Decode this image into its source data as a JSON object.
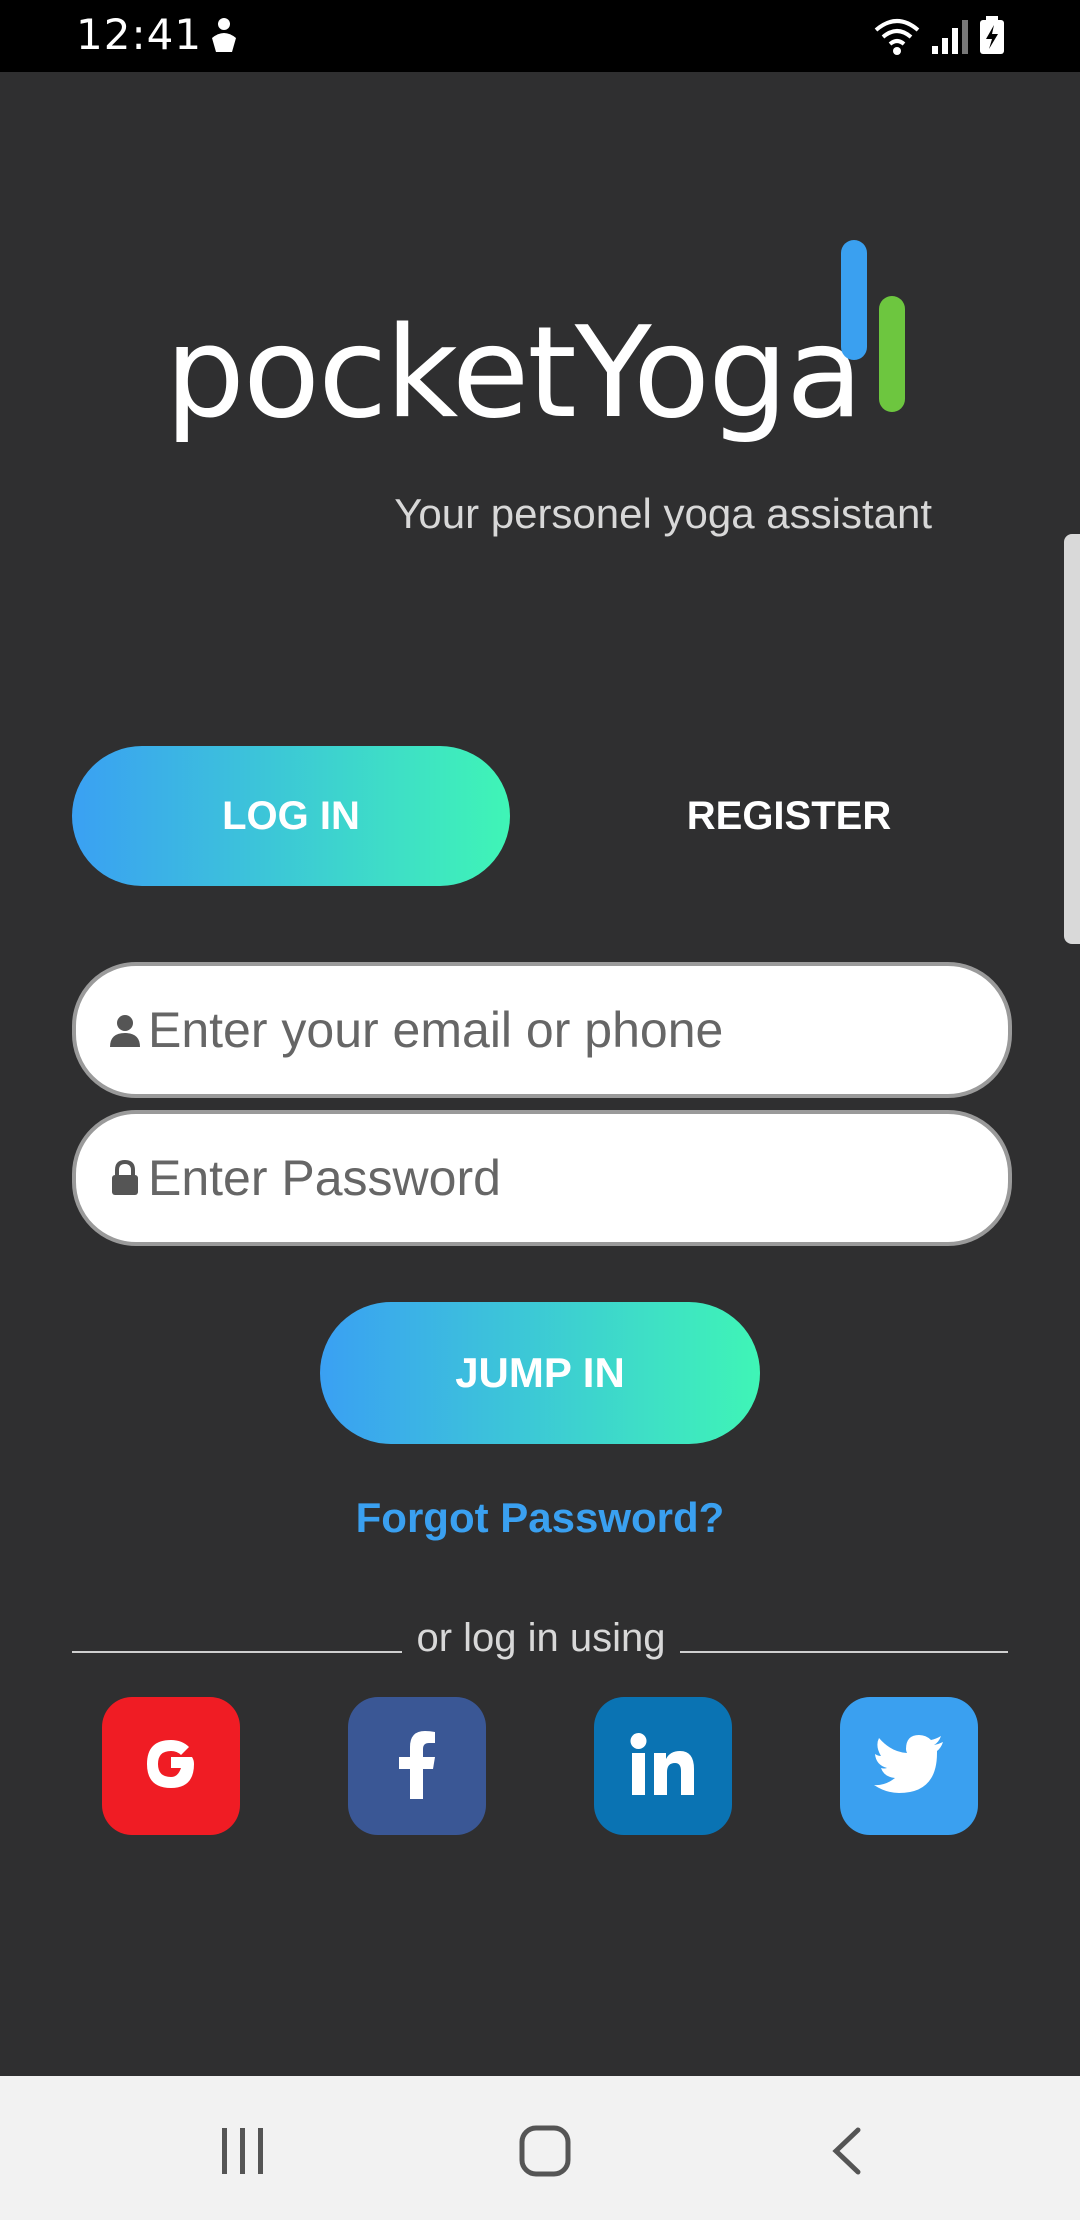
{
  "status_bar": {
    "time": "12:41"
  },
  "app": {
    "logo_text": "pocketYoga",
    "tagline": "Your personel yoga assistant",
    "brand_colors": {
      "blue": "#3aa0f0",
      "green": "#6dc63f",
      "gradient_start": "#3aa0f3",
      "gradient_end": "#3ff5b6"
    }
  },
  "tabs": {
    "login_label": "LOG IN",
    "register_label": "REGISTER",
    "active": "login"
  },
  "form": {
    "email_placeholder": "Enter your email or phone",
    "email_value": "",
    "email_icon": "person-icon",
    "password_placeholder": "Enter Password",
    "password_value": "",
    "password_icon": "lock-icon",
    "submit_label": "JUMP IN",
    "forgot_label": "Forgot Password?"
  },
  "social": {
    "divider_label": "or log in using",
    "providers": [
      {
        "name": "google",
        "icon": "google-icon",
        "color": "#f01c24"
      },
      {
        "name": "facebook",
        "icon": "facebook-icon",
        "color": "#3a5795"
      },
      {
        "name": "linkedin",
        "icon": "linkedin-icon",
        "color": "#0a73b3"
      },
      {
        "name": "twitter",
        "icon": "twitter-icon",
        "color": "#3aa0f0"
      }
    ]
  },
  "nav_bar": {
    "buttons": [
      "recents-icon",
      "home-icon",
      "back-icon"
    ]
  }
}
